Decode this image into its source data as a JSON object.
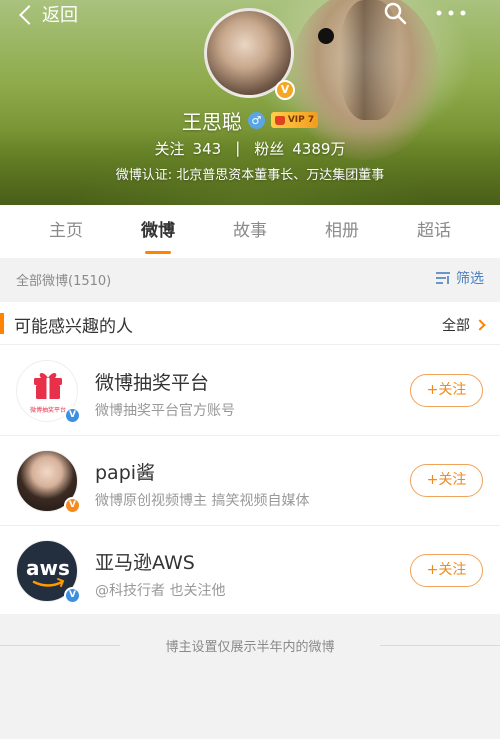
{
  "topbar": {
    "back_label": "返回"
  },
  "profile": {
    "name": "王思聪",
    "gender_symbol": "♂",
    "vip_label": "VIP 7",
    "follow_label": "关注",
    "follow_count": "343",
    "separator": "|",
    "fans_label": "粉丝",
    "fans_count": "4389万",
    "verification": "微博认证: 北京普思资本董事长、万达集团董事"
  },
  "tabs": [
    {
      "label": "主页"
    },
    {
      "label": "微博",
      "active": true
    },
    {
      "label": "故事"
    },
    {
      "label": "相册"
    },
    {
      "label": "超话"
    }
  ],
  "filter_bar": {
    "all_label": "全部微博(1510)",
    "filter_label": "筛选"
  },
  "suggestions": {
    "title": "可能感兴趣的人",
    "all_label": "全部",
    "people": [
      {
        "name": "微博抽奖平台",
        "desc": "微博抽奖平台官方账号",
        "logo_text": "微博抽奖平台",
        "badge_color": "#3d8fe0",
        "follow_label": "+关注"
      },
      {
        "name": "papi酱",
        "desc": "微博原创视频博主  搞笑视频自媒体",
        "badge_color": "#f58a1f",
        "follow_label": "+关注"
      },
      {
        "name": "亚马逊AWS",
        "desc": "@科技行者 也关注他",
        "logo_text": "aws",
        "badge_color": "#3d8fe0",
        "follow_label": "+关注"
      }
    ]
  },
  "footer": {
    "note": "博主设置仅展示半年内的微博"
  },
  "colors": {
    "accent": "#ff8200",
    "link": "#4a7fbf"
  }
}
